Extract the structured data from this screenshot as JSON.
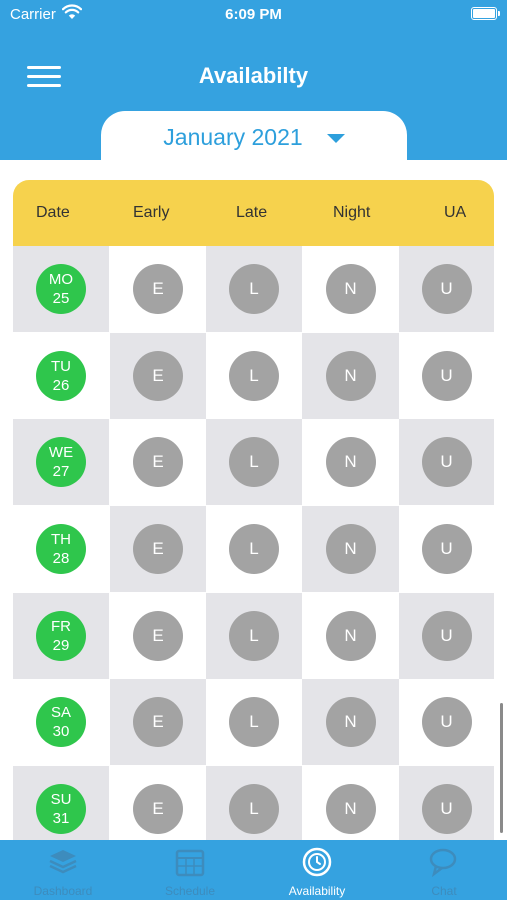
{
  "status_bar": {
    "carrier": "Carrier",
    "time": "6:09 PM"
  },
  "header": {
    "title": "Availabilty",
    "month": "January 2021"
  },
  "table": {
    "columns": [
      "Date",
      "Early",
      "Late",
      "Night",
      "UA"
    ],
    "shift_letters": [
      "E",
      "L",
      "N",
      "U"
    ],
    "rows": [
      {
        "day": "MO",
        "date": "25"
      },
      {
        "day": "TU",
        "date": "26"
      },
      {
        "day": "WE",
        "date": "27"
      },
      {
        "day": "TH",
        "date": "28"
      },
      {
        "day": "FR",
        "date": "29"
      },
      {
        "day": "SA",
        "date": "30"
      },
      {
        "day": "SU",
        "date": "31"
      }
    ]
  },
  "tabs": [
    {
      "label": "Dashboard",
      "icon": "dashboard-icon",
      "active": false
    },
    {
      "label": "Schedule",
      "icon": "calendar-icon",
      "active": false
    },
    {
      "label": "Availability",
      "icon": "availability-clock-icon",
      "active": true
    },
    {
      "label": "Chat",
      "icon": "chat-icon",
      "active": false
    }
  ],
  "colors": {
    "primary": "#35a2e0",
    "header_row": "#f6d24d",
    "date_badge": "#2fc64c",
    "shift_circle": "#a3a3a3",
    "cell_grey": "#e4e4e8"
  }
}
